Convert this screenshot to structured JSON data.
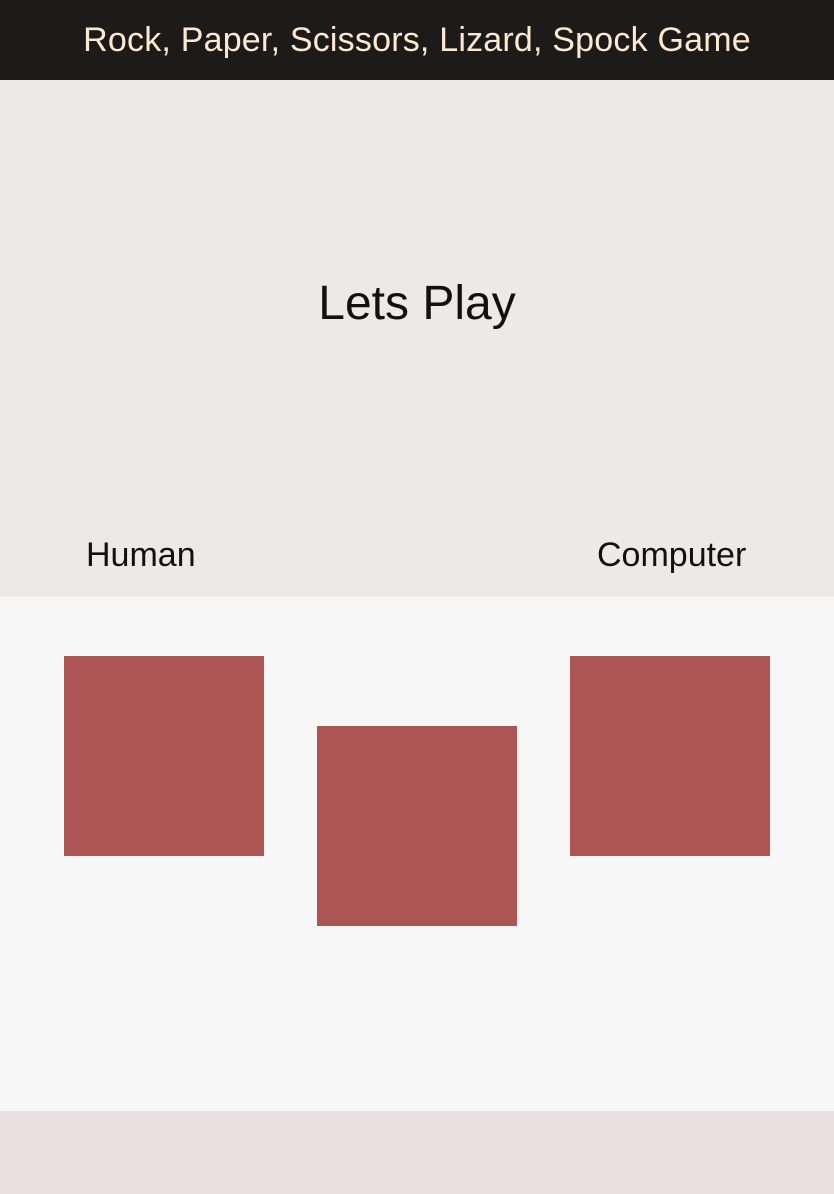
{
  "header": {
    "title": "Rock, Paper, Scissors, Lizard, Spock Game"
  },
  "stage": {
    "status": "Lets Play",
    "human_label": "Human",
    "computer_label": "Computer"
  },
  "colors": {
    "header_bg": "#1d1a1a",
    "header_text": "#fde9cf",
    "stage_bg": "#ebeae8",
    "board_bg": "#f7f7f7",
    "card": "#ad5454",
    "footer_bg": "#ebe0e0"
  }
}
